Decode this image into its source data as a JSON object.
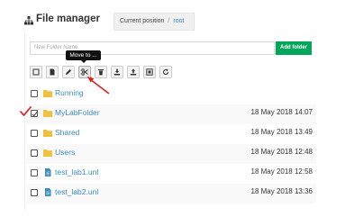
{
  "header": {
    "title": "File manager",
    "breadcrumb_label": "Current position",
    "breadcrumb_separator": "/",
    "breadcrumb_current": "root"
  },
  "new_folder": {
    "placeholder": "New Folder Name",
    "add_label": "Add folder"
  },
  "toolbar": {
    "buttons": [
      {
        "icon": "select-all-icon"
      },
      {
        "icon": "new-file-icon"
      },
      {
        "icon": "rename-icon"
      },
      {
        "icon": "cut-icon"
      },
      {
        "icon": "delete-icon"
      },
      {
        "icon": "download-icon"
      },
      {
        "icon": "upload-icon"
      },
      {
        "icon": "export-icon"
      },
      {
        "icon": "refresh-icon"
      }
    ],
    "tooltip": "Move to ..."
  },
  "files": [
    {
      "type": "folder",
      "name": "Running",
      "date": "",
      "checked": false
    },
    {
      "type": "folder",
      "name": "MyLabFolder",
      "date": "18 May 2018 14:07",
      "checked": true
    },
    {
      "type": "folder",
      "name": "Shared",
      "date": "18 May 2018 13:49",
      "checked": false
    },
    {
      "type": "folder",
      "name": "Users",
      "date": "18 May 2018 12:48",
      "checked": false
    },
    {
      "type": "file",
      "name": "test_lab1.unl",
      "date": "18 May 2018 12:58",
      "checked": false
    },
    {
      "type": "file",
      "name": "test_lab2.unl",
      "date": "18 May 2018 13:36",
      "checked": false
    }
  ],
  "colors": {
    "accent": "#3c8dbc",
    "folder": "#f0c040",
    "file": "#3c8dbc",
    "add_button": "#00a65a",
    "annotation": "#e02020"
  }
}
